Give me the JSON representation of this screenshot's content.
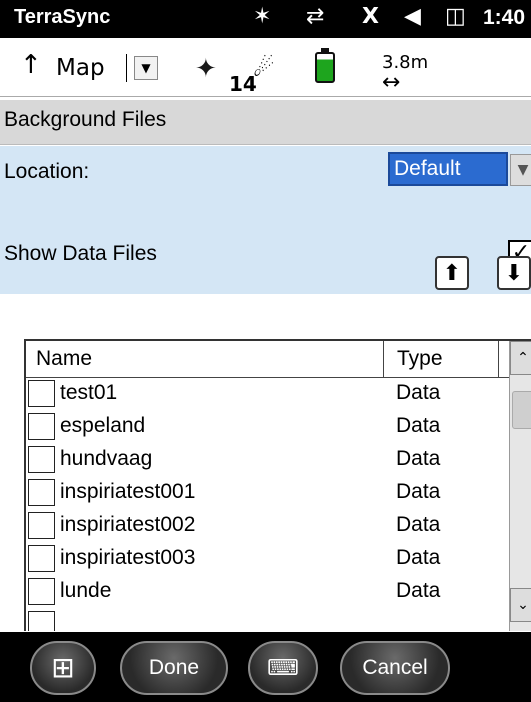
{
  "status": {
    "app": "TerraSync",
    "icons": [
      "bluetooth-icon",
      "connection-icon",
      "no-signal-icon",
      "volume-icon",
      "battery-icon"
    ],
    "time": "1:40"
  },
  "toolbar": {
    "map_label": "Map",
    "sat_count": "14",
    "accuracy": "3.8m"
  },
  "section_title": "Background Files",
  "location": {
    "label": "Location:",
    "value": "Default"
  },
  "show_data": {
    "label": "Show Data Files",
    "checked": true
  },
  "list": {
    "columns": [
      "Name",
      "Type"
    ],
    "rows": [
      {
        "name": "test01",
        "type": "Data"
      },
      {
        "name": "espeland",
        "type": "Data"
      },
      {
        "name": "hundvaag",
        "type": "Data"
      },
      {
        "name": "inspiriatest001",
        "type": "Data"
      },
      {
        "name": "inspiriatest002",
        "type": "Data"
      },
      {
        "name": "inspiriatest003",
        "type": "Data"
      },
      {
        "name": "lunde",
        "type": "Data"
      }
    ]
  },
  "bottom": {
    "done": "Done",
    "cancel": "Cancel"
  }
}
